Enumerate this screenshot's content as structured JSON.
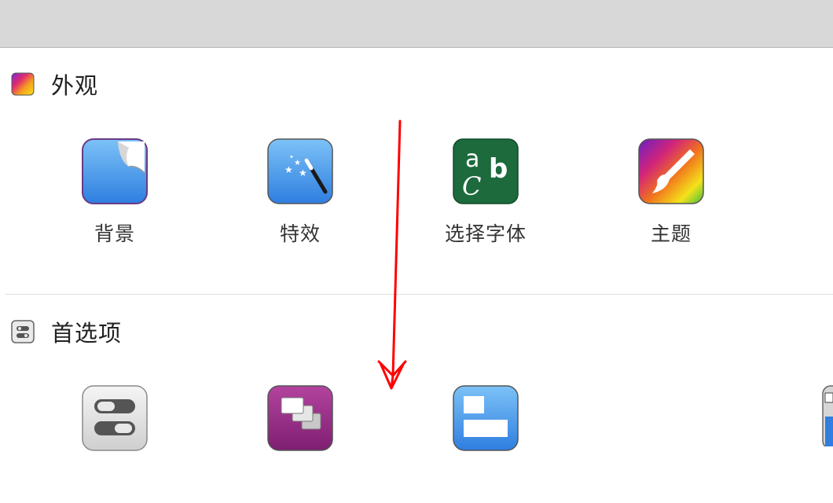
{
  "sections": {
    "appearance": {
      "title": "外观",
      "items": [
        {
          "label": "背景",
          "icon": "wallpaper-icon"
        },
        {
          "label": "特效",
          "icon": "magic-wand-icon"
        },
        {
          "label": "选择字体",
          "icon": "font-icon"
        },
        {
          "label": "主题",
          "icon": "theme-brush-icon"
        }
      ]
    },
    "preferences": {
      "title": "首选项",
      "items": [
        {
          "icon": "general-toggles-icon"
        },
        {
          "icon": "windows-icon"
        },
        {
          "icon": "layout-panel-icon"
        }
      ]
    }
  },
  "colors": {
    "topbar": "#d8d8d8",
    "annotation_arrow": "#ff0000"
  }
}
